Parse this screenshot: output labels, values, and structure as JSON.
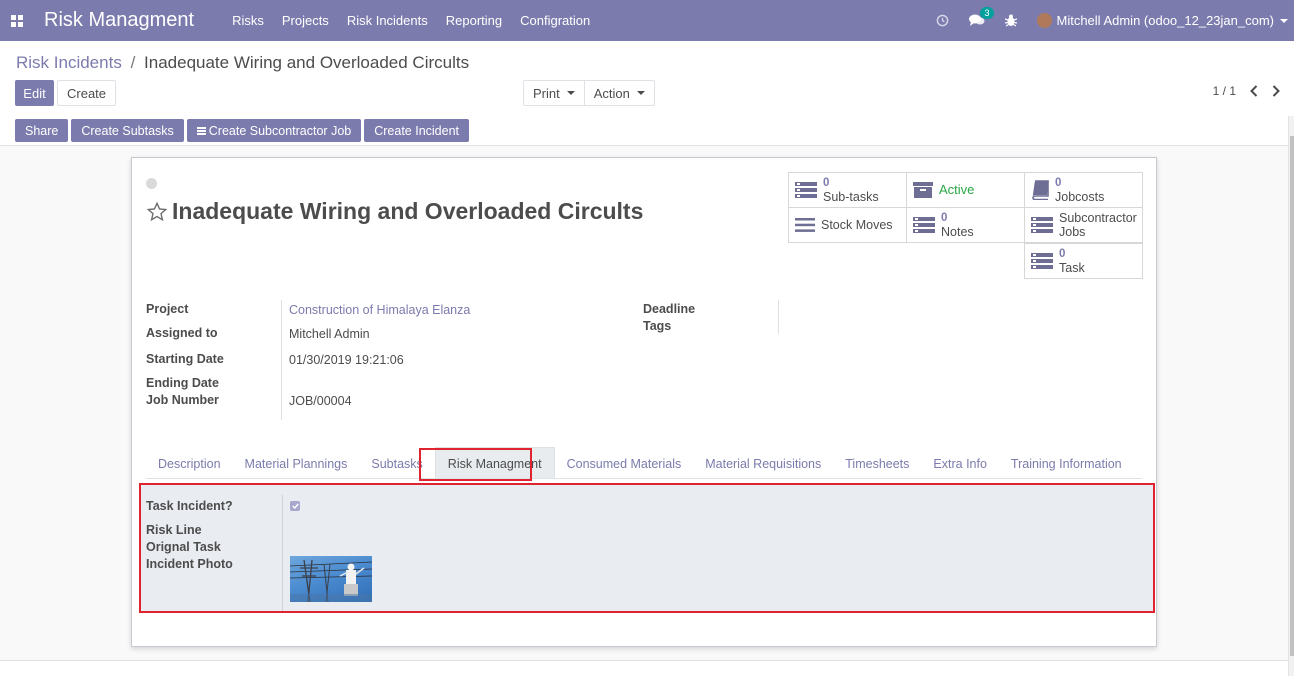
{
  "navbar": {
    "brand": "Risk Managment",
    "menu": [
      "Risks",
      "Projects",
      "Risk Incidents",
      "Reporting",
      "Configration"
    ],
    "messages_count": "3",
    "user": "Mitchell Admin (odoo_12_23jan_com)",
    "accent": "#7c7bad"
  },
  "breadcrumb": {
    "parent": "Risk Incidents",
    "separator": "/",
    "current": "Inadequate Wiring and Overloaded Circults"
  },
  "control_panel": {
    "edit": "Edit",
    "create": "Create",
    "print": "Print",
    "action": "Action",
    "pager": "1 / 1"
  },
  "header_buttons": {
    "share": "Share",
    "create_subtasks": "Create Subtasks",
    "create_subcontractor_job": "Create Subcontractor Job",
    "create_incident": "Create Incident"
  },
  "record": {
    "title": "Inadequate Wiring and Overloaded Circults"
  },
  "smart_buttons": {
    "subtasks": {
      "value": "0",
      "label": "Sub-tasks"
    },
    "active": {
      "label": "Active"
    },
    "jobcosts": {
      "value": "0",
      "label": "Jobcosts"
    },
    "stock_moves": {
      "label": "Stock Moves"
    },
    "notes": {
      "value": "0",
      "label": "Notes"
    },
    "subcontractor_jobs": {
      "label1": "Subcontractor",
      "label2": "Jobs"
    },
    "task": {
      "value": "0",
      "label": "Task"
    }
  },
  "fields": {
    "project_label": "Project",
    "project_value": "Construction of Himalaya Elanza",
    "assigned_label": "Assigned to",
    "assigned_value": "Mitchell Admin",
    "starting_label": "Starting Date",
    "starting_value": "01/30/2019 19:21:06",
    "ending_label": "Ending Date",
    "job_label": "Job Number",
    "job_value": "JOB/00004",
    "deadline_label": "Deadline",
    "tags_label": "Tags"
  },
  "tabs": [
    "Description",
    "Material Plannings",
    "Subtasks",
    "Risk Managment",
    "Consumed Materials",
    "Material Requisitions",
    "Timesheets",
    "Extra Info",
    "Training Information"
  ],
  "risk_tab": {
    "task_incident_label": "Task Incident?",
    "task_incident_checked": true,
    "risk_line_label": "Risk Line",
    "orignal_task_label": "Orignal Task",
    "incident_photo_label": "Incident Photo"
  }
}
